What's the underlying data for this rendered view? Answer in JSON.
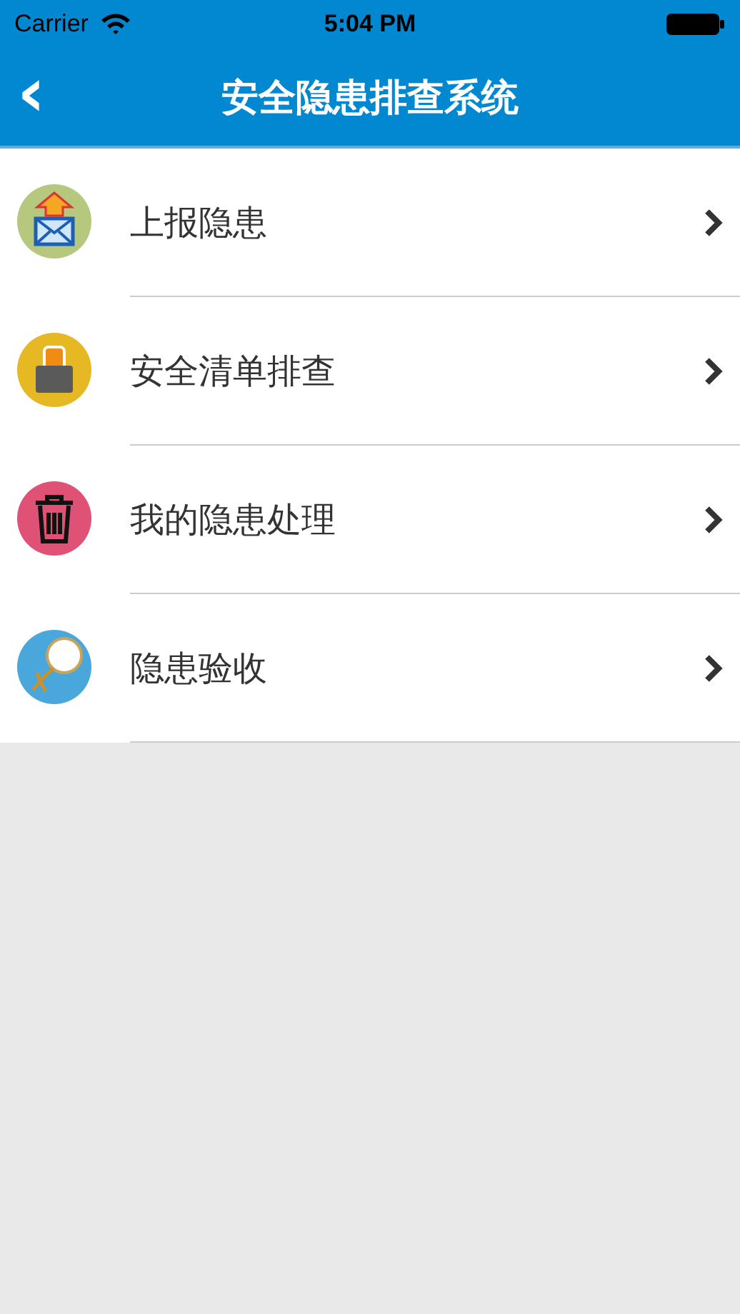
{
  "status_bar": {
    "carrier": "Carrier",
    "time": "5:04 PM"
  },
  "nav_bar": {
    "back": "‹",
    "title": "安全隐患排查系统"
  },
  "menu": [
    {
      "kind": "upload",
      "label": "上报隐患",
      "color": "#b6c77e"
    },
    {
      "kind": "lock",
      "label": "安全清单排查",
      "color": "#e6b823"
    },
    {
      "kind": "trash",
      "label": "我的隐患处理",
      "color": "#e05275"
    },
    {
      "kind": "magnifier",
      "label": "隐患验收",
      "color": "#4aa7dc"
    }
  ]
}
